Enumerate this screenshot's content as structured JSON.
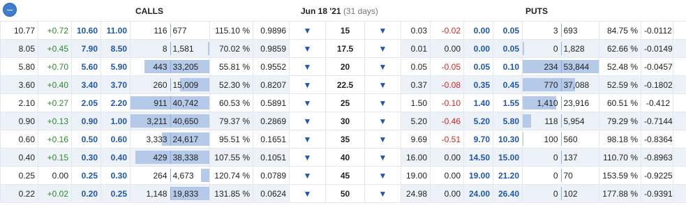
{
  "header": {
    "calls_label": "CALLS",
    "puts_label": "PUTS",
    "expiry_label": "Jun 18 '21",
    "expiry_days": "(31 days)"
  },
  "rows": [
    {
      "c_last": "10.77",
      "c_chg": "+0.72",
      "c_bid": "10.60",
      "c_ask": "11.00",
      "c_vol": "116",
      "c_oi": "677",
      "c_bar": 0.0,
      "c_iv": "115.10 %",
      "c_delta": "0.9896",
      "strike": "15",
      "p_last": "0.03",
      "p_chg": "-0.02",
      "p_bid": "0.00",
      "p_ask": "0.05",
      "p_vol": "3",
      "p_oi": "693",
      "p_bar": 0.0,
      "p_iv": "84.75 %",
      "p_delta": "-0.0112"
    },
    {
      "c_last": "8.05",
      "c_chg": "+0.45",
      "c_bid": "7.90",
      "c_ask": "8.50",
      "c_vol": "8",
      "c_oi": "1,581",
      "c_bar": 0.02,
      "c_iv": "70.02 %",
      "c_delta": "0.9859",
      "strike": "17.5",
      "p_last": "0.01",
      "p_chg": "0.00",
      "p_bid": "0.00",
      "p_ask": "0.05",
      "p_vol": "0",
      "p_oi": "1,828",
      "p_bar": 0.02,
      "p_iv": "62.66 %",
      "p_delta": "-0.0149"
    },
    {
      "c_last": "5.80",
      "c_chg": "+0.70",
      "c_bid": "5.60",
      "c_ask": "5.90",
      "c_vol": "443",
      "c_oi": "33,205",
      "c_bar": 0.82,
      "c_iv": "55.81 %",
      "c_delta": "0.9552",
      "strike": "20",
      "p_last": "0.05",
      "p_chg": "-0.05",
      "p_bid": "0.05",
      "p_ask": "0.10",
      "p_vol": "234",
      "p_oi": "53,844",
      "p_bar": 1.0,
      "p_iv": "52.48 %",
      "p_delta": "-0.0457"
    },
    {
      "c_last": "3.60",
      "c_chg": "+0.40",
      "c_bid": "3.40",
      "c_ask": "3.70",
      "c_vol": "260",
      "c_oi": "15,009",
      "c_bar": 0.37,
      "c_iv": "52.30 %",
      "c_delta": "0.8207",
      "strike": "22.5",
      "p_last": "0.37",
      "p_chg": "-0.08",
      "p_bid": "0.35",
      "p_ask": "0.45",
      "p_vol": "770",
      "p_oi": "37,088",
      "p_bar": 0.69,
      "p_iv": "52.59 %",
      "p_delta": "-0.1802"
    },
    {
      "c_last": "2.10",
      "c_chg": "+0.27",
      "c_bid": "2.05",
      "c_ask": "2.20",
      "c_vol": "911",
      "c_oi": "40,742",
      "c_bar": 1.0,
      "c_iv": "60.53 %",
      "c_delta": "0.5891",
      "strike": "25",
      "p_last": "1.50",
      "p_chg": "-0.10",
      "p_bid": "1.40",
      "p_ask": "1.55",
      "p_vol": "1,410",
      "p_oi": "23,916",
      "p_bar": 0.44,
      "p_iv": "60.51 %",
      "p_delta": "-0.412"
    },
    {
      "c_last": "0.90",
      "c_chg": "+0.13",
      "c_bid": "0.90",
      "c_ask": "1.00",
      "c_vol": "3,211",
      "c_oi": "40,650",
      "c_bar": 1.0,
      "c_iv": "79.37 %",
      "c_delta": "0.2869",
      "strike": "30",
      "p_last": "5.20",
      "p_chg": "-0.46",
      "p_bid": "5.20",
      "p_ask": "5.80",
      "p_vol": "118",
      "p_oi": "5,954",
      "p_bar": 0.11,
      "p_iv": "79.29 %",
      "p_delta": "-0.7144"
    },
    {
      "c_last": "0.60",
      "c_chg": "+0.16",
      "c_bid": "0.50",
      "c_ask": "0.60",
      "c_vol": "3,333",
      "c_oi": "24,617",
      "c_bar": 0.6,
      "c_iv": "95.51 %",
      "c_delta": "0.1651",
      "strike": "35",
      "p_last": "9.69",
      "p_chg": "-0.51",
      "p_bid": "9.70",
      "p_ask": "10.30",
      "p_vol": "100",
      "p_oi": "560",
      "p_bar": 0.01,
      "p_iv": "98.18 %",
      "p_delta": "-0.8364"
    },
    {
      "c_last": "0.40",
      "c_chg": "+0.15",
      "c_bid": "0.30",
      "c_ask": "0.40",
      "c_vol": "429",
      "c_oi": "38,338",
      "c_bar": 0.94,
      "c_iv": "107.55 %",
      "c_delta": "0.1051",
      "strike": "40",
      "p_last": "16.00",
      "p_chg": "0.00",
      "p_bid": "14.50",
      "p_ask": "15.00",
      "p_vol": "0",
      "p_oi": "137",
      "p_bar": 0.0,
      "p_iv": "110.70 %",
      "p_delta": "-0.8963"
    },
    {
      "c_last": "0.25",
      "c_chg": "0.00",
      "c_bid": "0.25",
      "c_ask": "0.30",
      "c_vol": "264",
      "c_oi": "4,673",
      "c_bar": 0.11,
      "c_iv": "120.74 %",
      "c_delta": "0.0789",
      "strike": "45",
      "p_last": "19.00",
      "p_chg": "0.00",
      "p_bid": "19.00",
      "p_ask": "21.20",
      "p_vol": "0",
      "p_oi": "70",
      "p_bar": 0.0,
      "p_iv": "153.59 %",
      "p_delta": "-0.9225"
    },
    {
      "c_last": "0.22",
      "c_chg": "+0.02",
      "c_bid": "0.20",
      "c_ask": "0.25",
      "c_vol": "1,148",
      "c_oi": "19,833",
      "c_bar": 0.49,
      "c_iv": "131.85 %",
      "c_delta": "0.0624",
      "strike": "50",
      "p_last": "24.98",
      "p_chg": "0.00",
      "p_bid": "24.00",
      "p_ask": "26.40",
      "p_vol": "0",
      "p_oi": "102",
      "p_bar": 0.0,
      "p_iv": "177.88 %",
      "p_delta": "-0.9391"
    }
  ],
  "colors": {
    "accent": "#1f56b3",
    "positive": "#2a8a2a",
    "negative": "#d62424",
    "bar": "#b5c9e8",
    "row_shade": "#edf2f8"
  },
  "icons": {
    "collapse": "minus-circle-icon",
    "caret": "caret-down-icon"
  }
}
